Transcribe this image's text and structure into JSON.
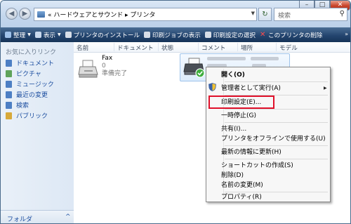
{
  "window": {
    "controls": {
      "minimize": "–",
      "maximize": "□",
      "close": "✕"
    }
  },
  "address": {
    "back_icon": "back-arrow-icon",
    "forward_icon": "forward-arrow-icon",
    "crumbs": "« ハードウェアとサウンド ▸ プリンタ",
    "refresh_icon": "refresh-icon"
  },
  "search": {
    "placeholder": "検索",
    "icon": "magnifier-icon"
  },
  "toolbar": {
    "organize": "整理",
    "view": "表示",
    "install_printer": "プリンタのインストール",
    "show_queue": "印刷ジョブの表示",
    "select_prefs": "印刷設定の選択",
    "delete_printer": "このプリンタの削除",
    "more": "»"
  },
  "nav": {
    "heading": "お気に入りリンク",
    "items": [
      {
        "label": "ドキュメント",
        "icon": "documents-icon",
        "color": "#4d7fc4"
      },
      {
        "label": "ピクチャ",
        "icon": "pictures-icon",
        "color": "#5fa35a"
      },
      {
        "label": "ミュージック",
        "icon": "music-icon",
        "color": "#4d7fc4"
      },
      {
        "label": "最近の変更",
        "icon": "recent-icon",
        "color": "#4d7fc4"
      },
      {
        "label": "検索",
        "icon": "search-folder-icon",
        "color": "#4d7fc4"
      },
      {
        "label": "パブリック",
        "icon": "public-icon",
        "color": "#d7a93a"
      }
    ],
    "folders_label": "フォルダ",
    "folders_chevron": "^"
  },
  "columns": [
    "名前",
    "ドキュメント",
    "状態",
    "コメント",
    "場所",
    "モデル"
  ],
  "items": {
    "fax": {
      "name": "Fax",
      "docs": "0",
      "status": "準備完了",
      "icon": "fax-printer-icon"
    },
    "printer": {
      "icon": "printer-default-icon"
    }
  },
  "context_menu": {
    "open": "開く(O)",
    "run_as_admin": "管理者として実行(A)",
    "print_prefs": "印刷設定(E)...",
    "pause": "一時停止(G)",
    "share": "共有(I)...",
    "use_offline": "プリンタをオフラインで使用する(U)",
    "refresh": "最新の情報に更新(H)",
    "create_shortcut": "ショートカットの作成(S)",
    "delete": "削除(D)",
    "rename": "名前の変更(M)",
    "properties": "プロパティ(R)",
    "shield_icon": "uac-shield-icon",
    "submenu_icon": "submenu-arrow-icon"
  },
  "colors": {
    "toolbar": "#24456f",
    "highlight": "#e0102a",
    "link": "#1d4fa0"
  }
}
